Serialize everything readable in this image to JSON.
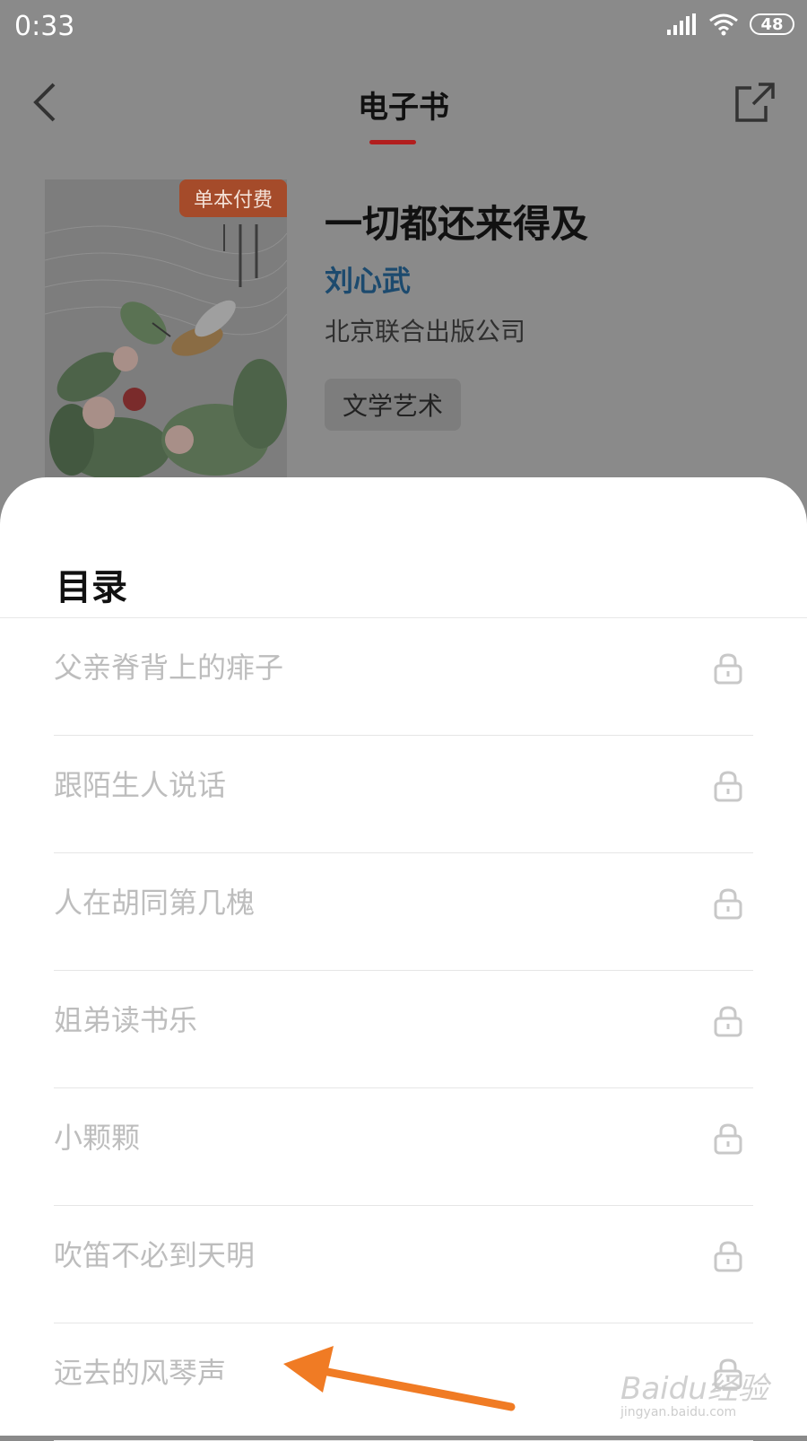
{
  "status_bar": {
    "time": "0:33",
    "battery": "48"
  },
  "header": {
    "title": "电子书"
  },
  "book": {
    "badge": "单本付费",
    "title": "一切都还来得及",
    "author": "刘心武",
    "publisher": "北京联合出版公司",
    "category": "文学艺术"
  },
  "toc": {
    "title": "目录",
    "items": [
      {
        "label": "父亲脊背上的痱子"
      },
      {
        "label": "跟陌生人说话"
      },
      {
        "label": "人在胡同第几槐"
      },
      {
        "label": "姐弟读书乐"
      },
      {
        "label": "小颗颗"
      },
      {
        "label": "吹笛不必到天明"
      },
      {
        "label": "远去的风琴声"
      }
    ]
  },
  "watermark": {
    "text": "Baidu经验",
    "url": "jingyan.baidu.com"
  },
  "colors": {
    "accent_red": "#b21e1e",
    "arrow_orange": "#f07b24",
    "author_blue": "#1c4a6e"
  }
}
